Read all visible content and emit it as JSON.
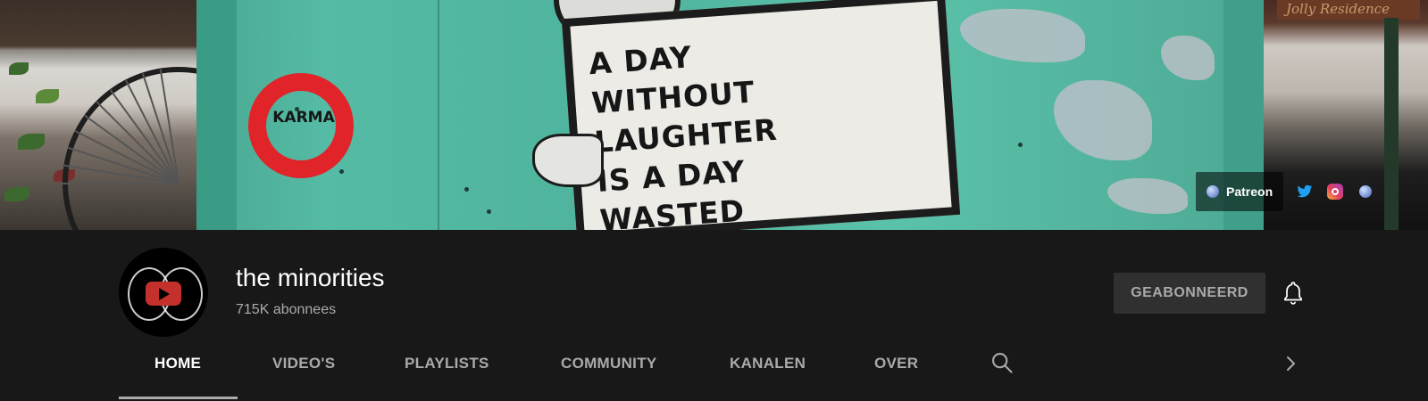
{
  "banner": {
    "poster_lines": [
      "A DAY WITHOUT",
      "LAUGHTER",
      "IS A DAY",
      "WASTED"
    ],
    "poster_stamp": "KARMA",
    "street_sign": "Jolly Residence",
    "links": {
      "patreon_label": "Patreon",
      "patreon_icon": "globe-icon",
      "twitter_icon": "twitter-icon",
      "instagram_icon": "instagram-icon",
      "website_icon": "globe-icon"
    }
  },
  "channel": {
    "name": "the minorities",
    "subscribers": "715K abonnees",
    "subscribe_label": "GEABONNEERD",
    "bell_icon": "bell-icon"
  },
  "tabs": [
    {
      "label": "HOME",
      "active": true
    },
    {
      "label": "VIDEO'S",
      "active": false
    },
    {
      "label": "PLAYLISTS",
      "active": false
    },
    {
      "label": "COMMUNITY",
      "active": false
    },
    {
      "label": "KANALEN",
      "active": false
    },
    {
      "label": "OVER",
      "active": false
    }
  ],
  "colors": {
    "background": "#181818",
    "tab_text": "#aaaaaa",
    "tab_active": "#ffffff",
    "subscribe_bg": "#303030",
    "youtube_red": "#c4302b"
  }
}
